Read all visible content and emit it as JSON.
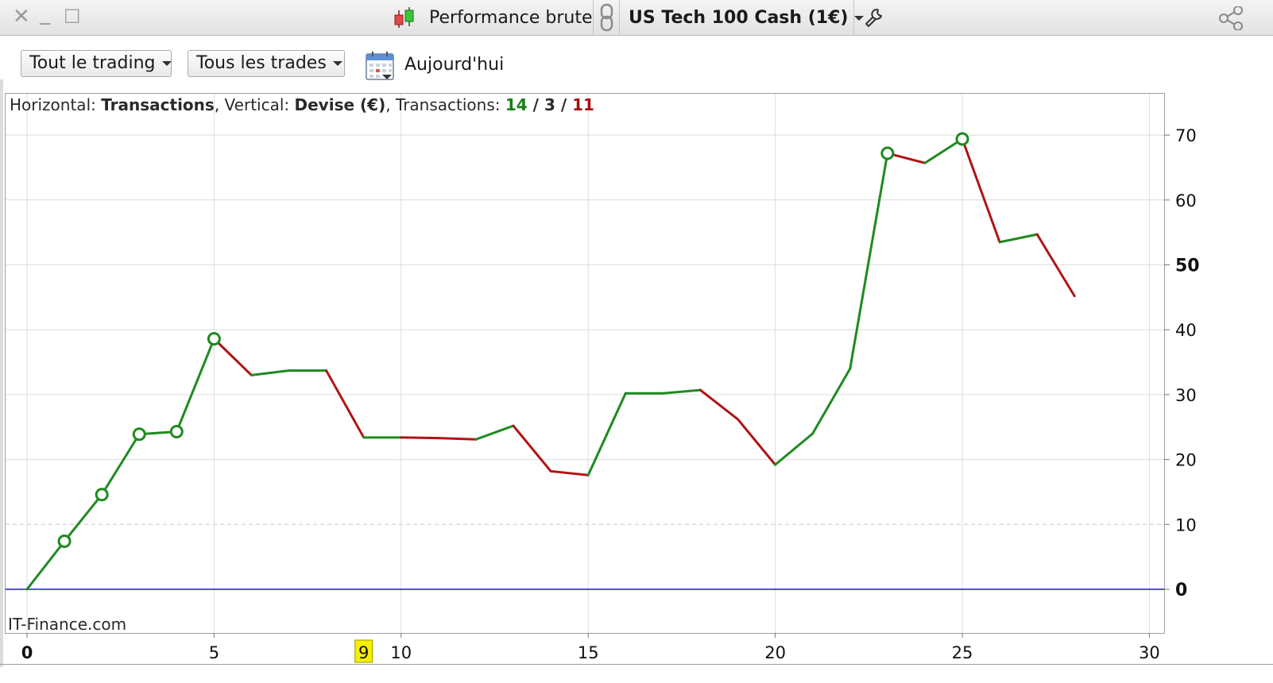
{
  "titlebar": {
    "close_glyph": "✕",
    "minimize_glyph": "_",
    "maximize_glyph": "☐",
    "chart_icon": "candlestick-chart-icon",
    "title": "Performance brute",
    "link_icon": "chain-link-icon",
    "instrument": "US Tech 100 Cash (1€)",
    "settings_icon": "wrench-icon",
    "share_icon": "share-icon"
  },
  "toolbar": {
    "filter_trading": "Tout le trading",
    "filter_trades": "Tous les trades",
    "calendar_icon": "calendar-icon",
    "date_label": "Aujourd'hui"
  },
  "chart_info": {
    "horizontal_prefix": "Horizontal: ",
    "horizontal_value": "Transactions",
    "vertical_prefix": ", Vertical: ",
    "vertical_value": "Devise (€)",
    "transactions_prefix": ", Transactions: ",
    "winners": "14",
    "slash1": " / ",
    "neutral": "3",
    "slash2": " / ",
    "losers": "11"
  },
  "watermark": "IT-Finance.com",
  "colors": {
    "up": "#1f8a1f",
    "down": "#b01515",
    "zero_line": "#1a1ad0",
    "grid": "#dcdcdc",
    "highlight": "#f5f000"
  },
  "chart_data": {
    "type": "line",
    "xlabel": "Transactions",
    "ylabel": "Devise (€)",
    "xlim": [
      0,
      30
    ],
    "ylim": [
      -7,
      76
    ],
    "x_ticks": [
      "0",
      "5",
      "10",
      "15",
      "20",
      "25",
      "30"
    ],
    "y_ticks": [
      "0",
      "10",
      "20",
      "30",
      "40",
      "50",
      "60",
      "70"
    ],
    "y_tick_values": [
      0,
      10,
      20,
      30,
      40,
      50,
      60,
      70
    ],
    "highlighted_x": "9",
    "grid": true,
    "x": [
      0,
      1,
      2,
      3,
      4,
      5,
      6,
      7,
      8,
      9,
      10,
      11,
      12,
      13,
      14,
      15,
      16,
      17,
      18,
      19,
      20,
      21,
      22,
      23,
      24,
      25,
      26,
      27,
      28
    ],
    "y": [
      0,
      7.4,
      14.6,
      23.9,
      24.3,
      38.6,
      33,
      33.7,
      33.7,
      23.4,
      23.4,
      23.3,
      23.1,
      25.2,
      18.2,
      17.6,
      30.2,
      30.2,
      30.7,
      26.2,
      19.2,
      24,
      34,
      67.2,
      65.7,
      69.4,
      53.5,
      54.7,
      45.2
    ],
    "markers_at": [
      1,
      2,
      3,
      4,
      5,
      23,
      25
    ]
  }
}
